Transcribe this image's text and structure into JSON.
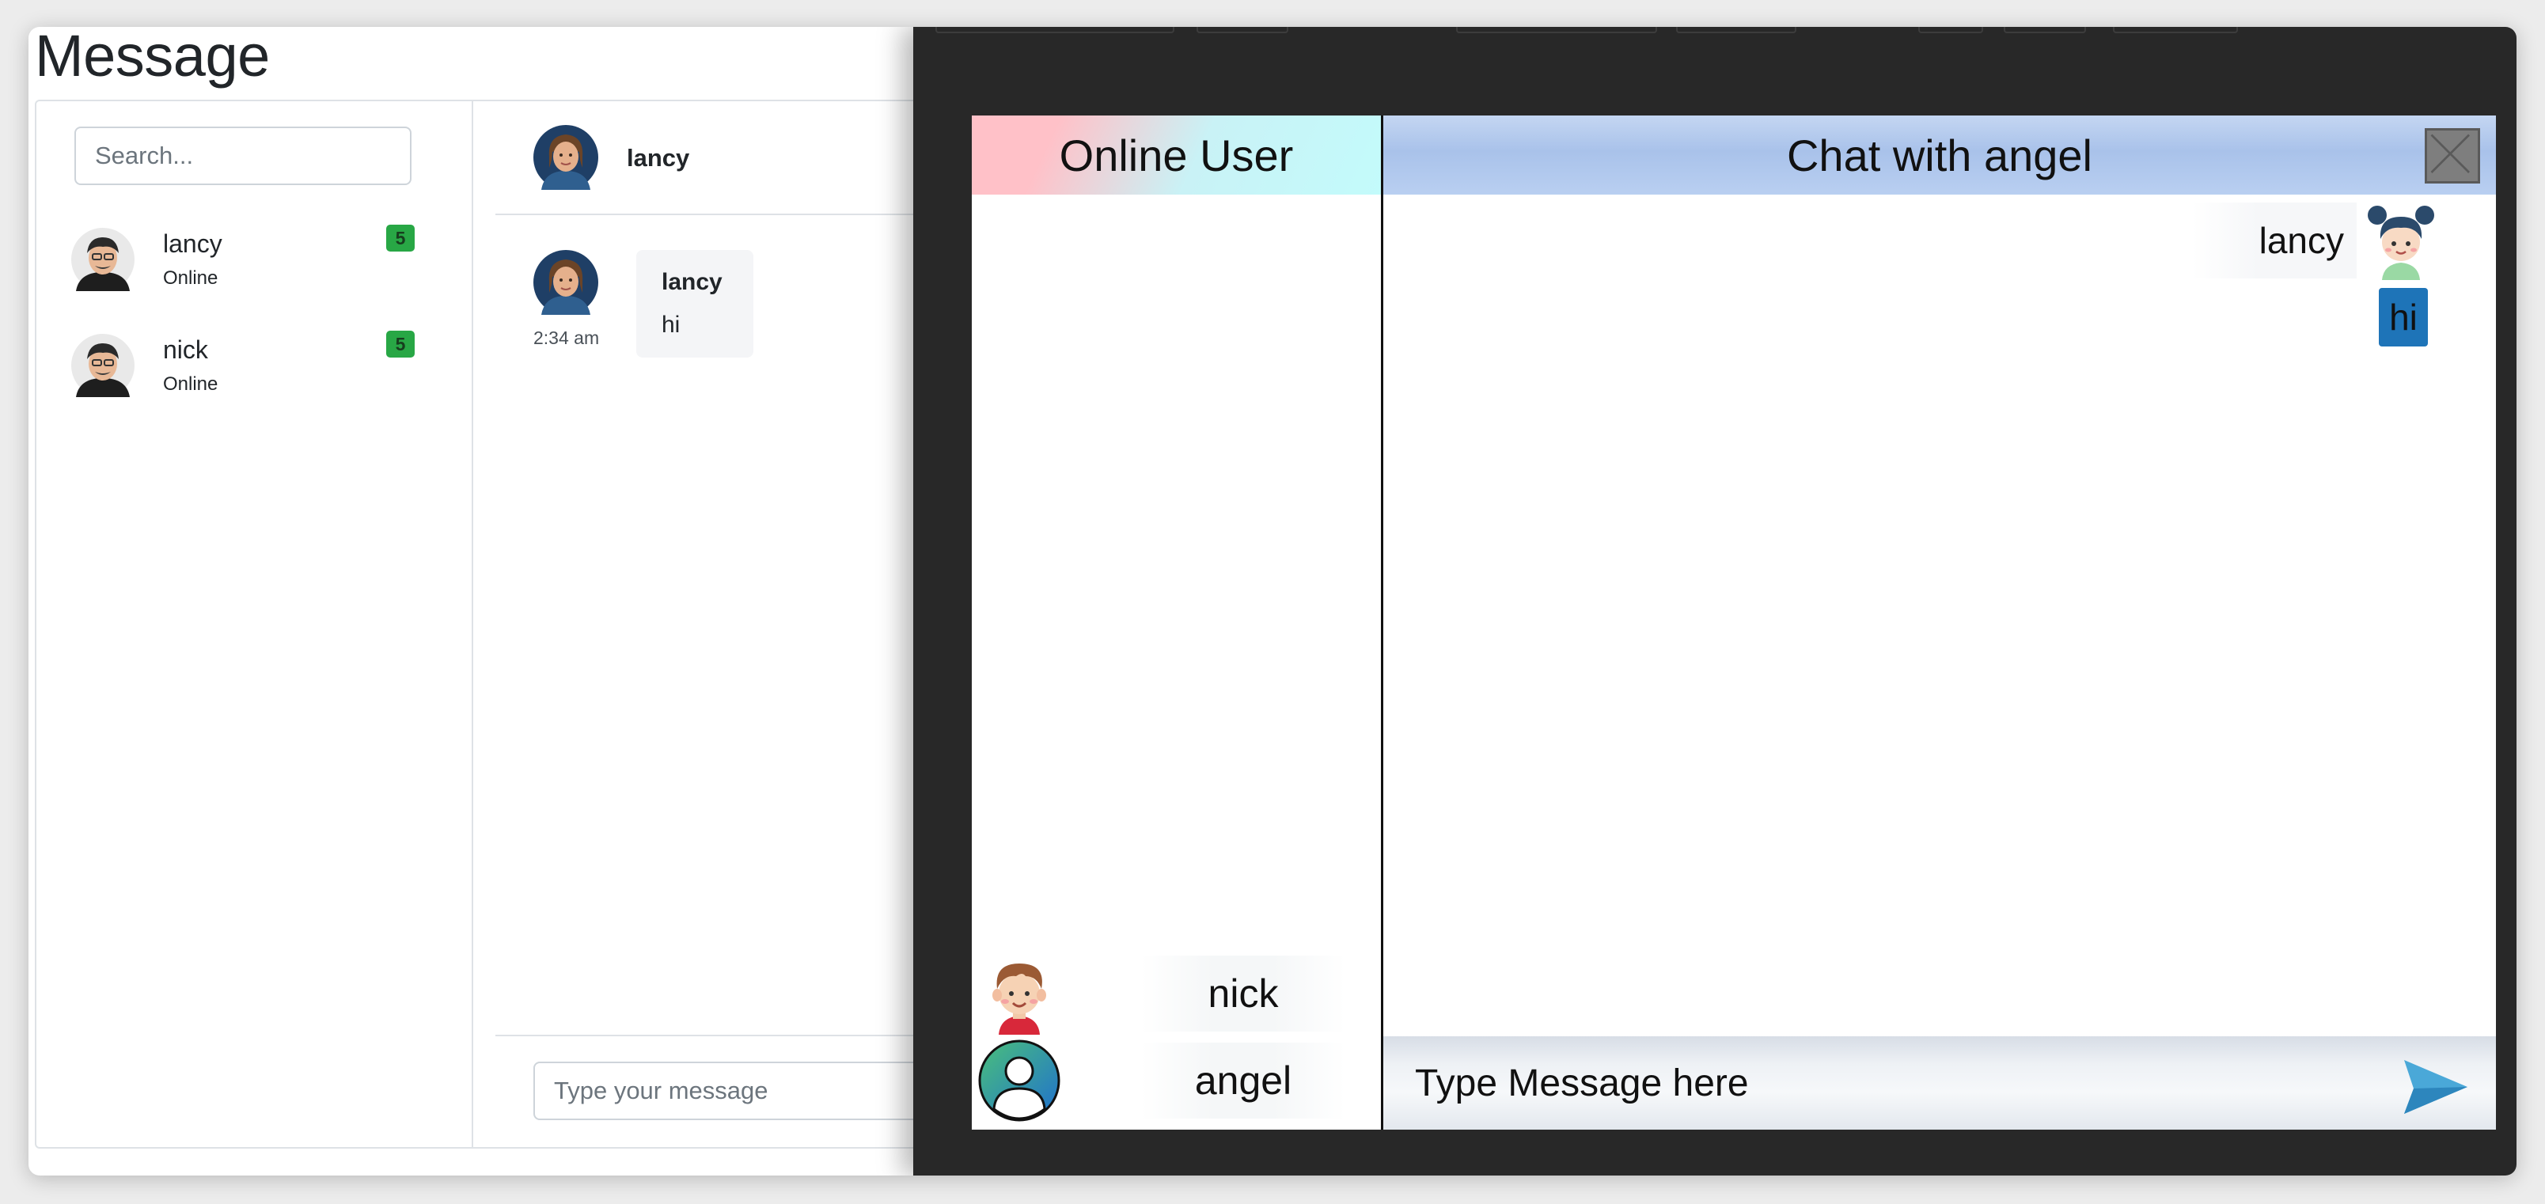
{
  "page": {
    "title": "Message"
  },
  "contacts": {
    "search_placeholder": "Search...",
    "items": [
      {
        "name": "lancy",
        "status": "Online",
        "badge": "5",
        "avatar_icon": "cartoon-man-avatar-icon"
      },
      {
        "name": "nick",
        "status": "Online",
        "badge": "5",
        "avatar_icon": "cartoon-man-avatar-icon"
      }
    ]
  },
  "chat": {
    "header_name": "lancy",
    "messages": [
      {
        "sender": "lancy",
        "text": "hi",
        "time": "2:34 am"
      }
    ],
    "input_placeholder": "Type your message"
  },
  "overlay_chat": {
    "online_title": "Online User",
    "online_users": [
      {
        "name": "nick",
        "avatar_icon": "cartoon-boy-avatar-icon"
      },
      {
        "name": "angel",
        "avatar_icon": "default-user-avatar-icon"
      }
    ],
    "conversation_title": "Chat with angel",
    "self_message": {
      "sender": "lancy",
      "text": "hi",
      "avatar_icon": "cartoon-girl-avatar-icon"
    },
    "input_placeholder": "Type Message here",
    "send_icon": "paper-plane-send-icon",
    "close_icon": "close-icon"
  },
  "colors": {
    "badge_green": "#28a745",
    "overlay_bg": "#282828",
    "bubble_blue": "#1e74b8",
    "send_blue": "#4aa8d8"
  }
}
